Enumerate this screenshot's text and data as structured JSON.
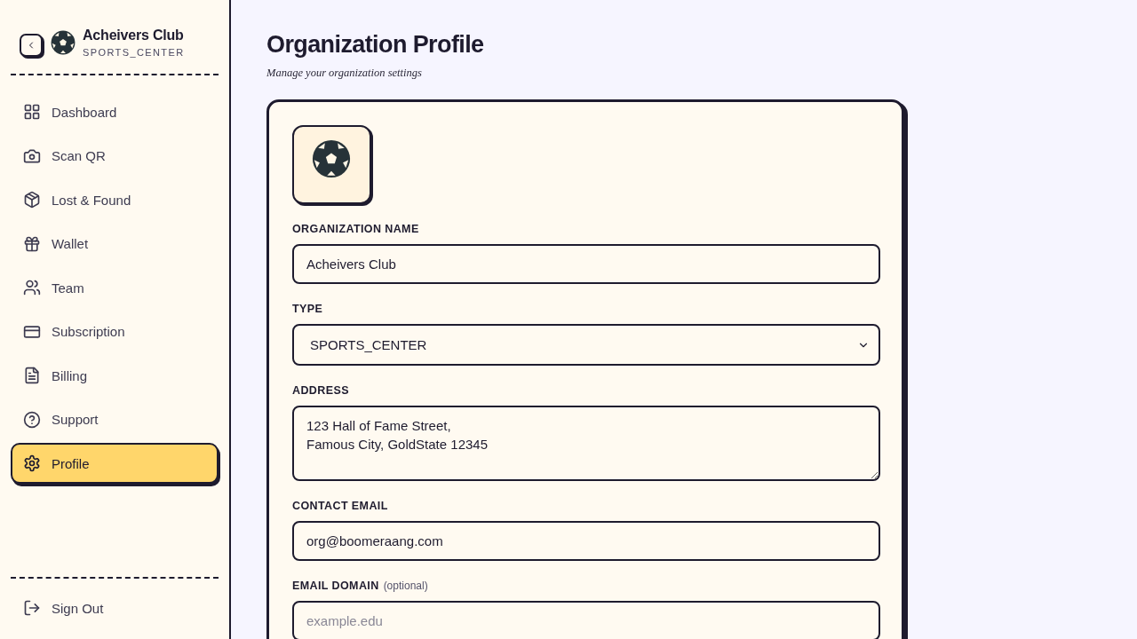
{
  "sidebar": {
    "brand": {
      "name": "Acheivers Club",
      "type": "SPORTS_CENTER"
    },
    "nav_items": [
      {
        "label": "Dashboard",
        "selected": false
      },
      {
        "label": "Scan QR",
        "selected": false
      },
      {
        "label": "Lost & Found",
        "selected": false
      },
      {
        "label": "Wallet",
        "selected": false
      },
      {
        "label": "Team",
        "selected": false
      },
      {
        "label": "Subscription",
        "selected": false
      },
      {
        "label": "Billing",
        "selected": false
      },
      {
        "label": "Support",
        "selected": false
      },
      {
        "label": "Profile",
        "selected": true
      }
    ],
    "sign_out": {
      "label": "Sign Out"
    }
  },
  "page": {
    "title": "Organization Profile",
    "subtitle": "Manage your organization settings"
  },
  "form": {
    "fields": [
      {
        "kind": "text",
        "label": "ORGANIZATION NAME",
        "value": "Acheivers Club"
      },
      {
        "kind": "select",
        "label": "TYPE",
        "value": "SPORTS_CENTER"
      },
      {
        "kind": "textarea",
        "label": "ADDRESS",
        "value": "123 Hall of Fame Street,\nFamous City, GoldState 12345"
      },
      {
        "kind": "text",
        "label": "CONTACT EMAIL",
        "value": "org@boomeraang.com"
      },
      {
        "kind": "text",
        "label": "EMAIL DOMAIN",
        "note": "(optional)",
        "placeholder": "example.edu"
      }
    ]
  }
}
